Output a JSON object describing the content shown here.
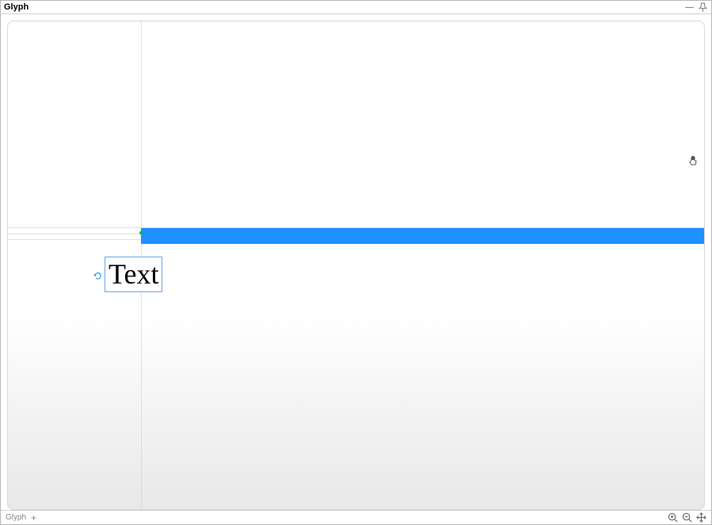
{
  "header": {
    "title": "Glyph"
  },
  "canvas": {
    "text_content": "Text",
    "blue_bar_color": "#1e90ff"
  },
  "footer": {
    "tab_label": "Glyph"
  }
}
